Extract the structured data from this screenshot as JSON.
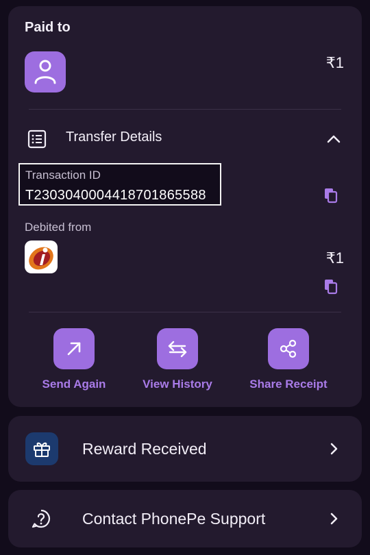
{
  "payment": {
    "paid_to_label": "Paid to",
    "amount": "₹1"
  },
  "transfer_details": {
    "title": "Transfer Details",
    "transaction_id_label": "Transaction ID",
    "transaction_id": "T2303040004418701865588",
    "debited_from_label": "Debited from",
    "debited_amount": "₹1"
  },
  "actions": [
    {
      "label": "Send Again",
      "icon": "arrow-up-right-icon"
    },
    {
      "label": "View History",
      "icon": "swap-arrows-icon"
    },
    {
      "label": "Share Receipt",
      "icon": "share-icon"
    }
  ],
  "reward": {
    "label": "Reward Received",
    "icon": "gift-icon"
  },
  "support": {
    "label": "Contact PhonePe Support",
    "icon": "help-icon"
  },
  "colors": {
    "background": "#120c1b",
    "card": "#231a2e",
    "accent": "#9d6ee0",
    "accent_text": "#a97be8",
    "gift_tile": "#1c3a6e"
  }
}
